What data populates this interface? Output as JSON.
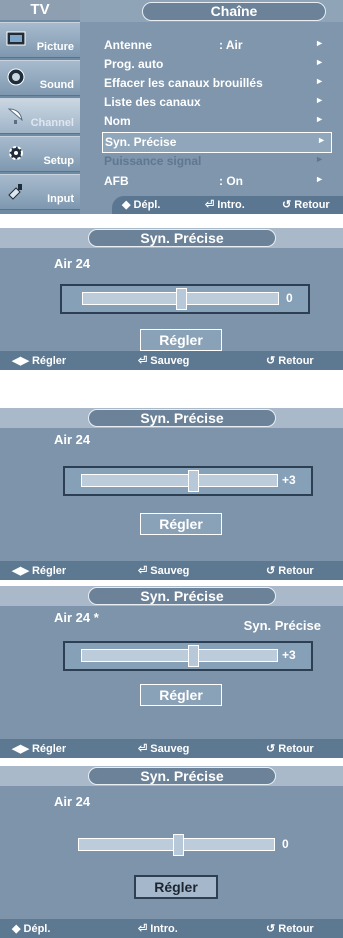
{
  "menu": {
    "tv_label": "TV",
    "title": "Chaîne",
    "sidebar": [
      {
        "label": "Picture",
        "icon": "picture-icon"
      },
      {
        "label": "Sound",
        "icon": "sound-icon"
      },
      {
        "label": "Channel",
        "icon": "satellite-dish-icon"
      },
      {
        "label": "Setup",
        "icon": "setup-gear-icon"
      },
      {
        "label": "Input",
        "icon": "input-plug-icon"
      }
    ],
    "items": [
      {
        "label": "Antenne",
        "value": ": Air",
        "arrow": "►"
      },
      {
        "label": "Prog. auto",
        "value": "",
        "arrow": "►"
      },
      {
        "label": "Effacer les canaux brouillés",
        "value": "",
        "arrow": "►"
      },
      {
        "label": "Liste des canaux",
        "value": "",
        "arrow": "►"
      },
      {
        "label": "Nom",
        "value": "",
        "arrow": "►"
      },
      {
        "label": "Syn. Précise",
        "value": "",
        "arrow": "►"
      },
      {
        "label": "Puissance signal",
        "value": "",
        "arrow": "►"
      },
      {
        "label": "AFB",
        "value": ": On",
        "arrow": "►"
      }
    ],
    "footer": {
      "move": "◆ Dépl.",
      "enter": "⏎ Intro.",
      "return": "↺ Retour"
    }
  },
  "fine_tune_screens": [
    {
      "title": "Syn. Précise",
      "channel": "Air 24",
      "right_text": "",
      "value": "0",
      "level": 0,
      "button": "Régler",
      "footer": {
        "adjust": "◀▶ Régler",
        "save": "⏎ Sauveg",
        "return": "↺ Retour"
      }
    },
    {
      "title": "Syn. Précise",
      "channel": "Air 24",
      "right_text": "",
      "value": "+3",
      "level": 3,
      "button": "Régler",
      "footer": {
        "adjust": "◀▶ Régler",
        "save": "⏎ Sauveg",
        "return": "↺ Retour"
      }
    },
    {
      "title": "Syn. Précise",
      "channel": "Air 24 *",
      "right_text": "Syn. Précise",
      "value": "+3",
      "level": 3,
      "button": "Régler",
      "footer": {
        "adjust": "◀▶ Régler",
        "save": "⏎ Sauveg",
        "return": "↺ Retour"
      }
    },
    {
      "title": "Syn. Précise",
      "channel": "Air 24",
      "right_text": "",
      "value": "0",
      "level": 0,
      "button": "Régler",
      "footer": {
        "adjust": "◆ Dépl.",
        "save": "⏎ Intro.",
        "return": "↺ Retour"
      }
    }
  ],
  "colors": {
    "accent": "#7f96ac",
    "dark_border": "#2d3f52"
  }
}
